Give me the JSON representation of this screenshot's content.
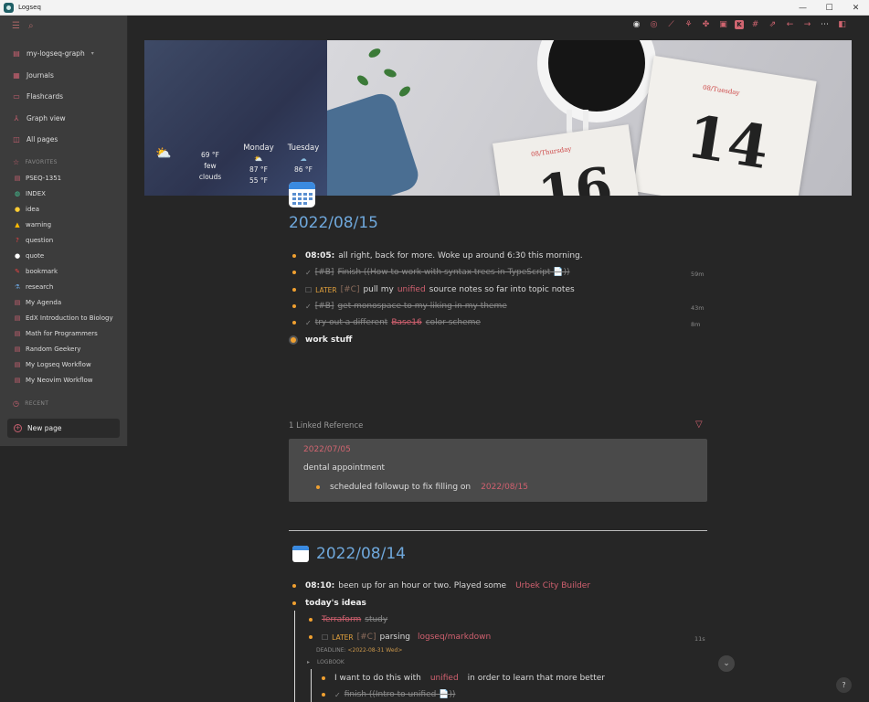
{
  "window": {
    "title": "Logseq",
    "controls": [
      "—",
      "☐",
      "✕"
    ]
  },
  "sidebar": {
    "graph": "my-logseq-graph",
    "graph_caret": "▾",
    "nav": [
      {
        "label": "Journals",
        "icon": "calendar-icon"
      },
      {
        "label": "Flashcards",
        "icon": "cards-icon"
      },
      {
        "label": "Graph view",
        "icon": "graph-icon"
      },
      {
        "label": "All pages",
        "icon": "pages-icon"
      }
    ],
    "favorites_header": "FAVORITES",
    "favorites": [
      {
        "label": "PSEQ-1351",
        "icon": "page-icon"
      },
      {
        "label": "INDEX",
        "icon": "globe-icon"
      },
      {
        "label": "idea",
        "icon": "bulb-icon"
      },
      {
        "label": "warning",
        "icon": "warning-icon"
      },
      {
        "label": "question",
        "icon": "question-icon"
      },
      {
        "label": "quote",
        "icon": "speech-icon"
      },
      {
        "label": "bookmark",
        "icon": "pin-icon"
      },
      {
        "label": "research",
        "icon": "research-icon"
      },
      {
        "label": "My Agenda",
        "icon": "page-icon"
      },
      {
        "label": "EdX Introduction to Biology",
        "icon": "page-icon"
      },
      {
        "label": "Math for Programmers",
        "icon": "page-icon"
      },
      {
        "label": "Random Geekery",
        "icon": "page-icon"
      },
      {
        "label": "My Logseq Workflow",
        "icon": "page-icon"
      },
      {
        "label": "My Neovim Workflow",
        "icon": "page-icon"
      }
    ],
    "recent_header": "RECENT",
    "new_page": "New page"
  },
  "weather": {
    "now_temp": "69 °F",
    "now_cond_1": "few",
    "now_cond_2": "clouds",
    "day1": {
      "name": "Monday",
      "hi": "87 °F",
      "lo": "55 °F"
    },
    "day2": {
      "name": "Tuesday",
      "hi": "86 °F"
    }
  },
  "hero_calendar": {
    "big1": "14",
    "big2": "16",
    "day1": "08/Tuesday",
    "day2": "08/Thursday"
  },
  "journal1": {
    "title": "2022/08/15",
    "b1_time": "08:05:",
    "b1_text": "all right, back for more. Woke up around 6:30 this morning.",
    "b2_tag": "[#B]",
    "b2_text": "Finish ((How to work with syntax trees in TypeScript 📄))",
    "b2_time": "59m",
    "b3_marker": "LATER",
    "b3_tag": "[#C]",
    "b3_pre": "pull my",
    "b3_link": "unified",
    "b3_post": "source notes so far into topic notes",
    "b4_tag": "[#B]",
    "b4_text": "get monospace to my liking in my theme",
    "b4_time": "43m",
    "b5_pre": "try out a different",
    "b5_link": "Base16",
    "b5_post": "color scheme",
    "b5_time": "8m",
    "b6_text": "work stuff"
  },
  "linked_ref": {
    "title": "1 Linked Reference",
    "date": "2022/07/05",
    "text1": "dental appointment",
    "text2": "scheduled followup to fix filling on",
    "text2_link": "2022/08/15"
  },
  "journal2": {
    "title": "2022/08/14",
    "b1_time": "08:10:",
    "b1_text": "been up for an hour or two. Played some",
    "b1_link": "Urbek City Builder",
    "b2_text": "today's ideas",
    "b3_link": "Terraform",
    "b3_text": "study",
    "b4_marker": "LATER",
    "b4_tag": "[#C]",
    "b4_text": "parsing",
    "b4_link": "logseq/markdown",
    "b4_time": "11s",
    "deadline_label": "DEADLINE:",
    "deadline_value": "<2022-08-31 Wed>",
    "logbook": "LOGBOOK",
    "b5_pre": "I want to do this with",
    "b5_link": "unified",
    "b5_post": "in order to learn that more better",
    "b6_text": "finish ((Intro to unified 📄))"
  },
  "colors": {
    "accent": "#d0606f",
    "title_blue": "#6fa8dc",
    "bullet": "#f0a030",
    "later": "#e0a03c"
  }
}
